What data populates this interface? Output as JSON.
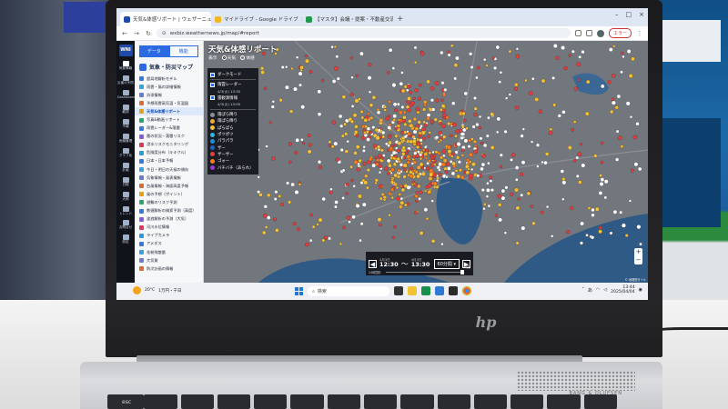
{
  "browser": {
    "tabs": [
      {
        "label": "天気&体感リポート | ウェザーニュース",
        "color": "#1f4aa8"
      },
      {
        "label": "マイドライブ - Google ドライブ",
        "color": "#f2b81c"
      },
      {
        "label": "【マスタ】会議・提案・不動産交流",
        "color": "#1e9a4a"
      }
    ],
    "url": "wxbiz.weathernews.jp/map/#report",
    "error_label": "エラー"
  },
  "rail": {
    "logo": "WNI",
    "items": [
      "気象情報",
      "災害の予防",
      "Dashboard",
      "観測",
      "予報",
      "危機管理",
      "グラフ化",
      "計画",
      "日程",
      "大雨",
      "トレンド",
      "お問合せ",
      "設定"
    ]
  },
  "sidebar": {
    "seg": [
      "データ",
      "機能"
    ],
    "heading": "気象・防災マップ",
    "items": [
      "超局地解析モデル",
      "雨雲・風の詳細情報",
      "渋滞情報",
      "予想雨雲高気温・気温図",
      "天気&体感リポート",
      "写真&動画リポート",
      "雨雲レーダー&落雷",
      "雷の状況・落雷リスク",
      "浸水リスクモニタリング",
      "危険度分布（キキクル）",
      "日本・日本予報",
      "今日・明日の天候の傾向",
      "気象情報・発表情報",
      "台風情報・海面高度予報",
      "風の予想（ポイント）",
      "避難のリスク予測",
      "数値解析の検索予測（高度）",
      "波浪解析の予測（大気）",
      "河川水位情報",
      "ライブカメラ",
      "アメダス",
      "花粉飛散量",
      "大気質",
      "防災計画の情報"
    ],
    "active_index": 4,
    "weather": {
      "temp": "20°C",
      "desc": "1万円・千日"
    }
  },
  "map": {
    "title": "天気&体感リポート",
    "radios": [
      "天気",
      "体感"
    ],
    "radio_prefix": "表示",
    "legend": {
      "dark_mode": "ダークモード",
      "layers": [
        {
          "label": "雨雲レーダー",
          "time": "4/3(火) 13:35"
        },
        {
          "label": "雷観測情報",
          "time": "4/3(火) 13:00"
        }
      ],
      "categories": [
        {
          "label": "雨ぱら降り",
          "color": "#8a8f99"
        },
        {
          "label": "雨ぱら降り",
          "color": "#f2a92a"
        },
        {
          "label": "ぱらぱら",
          "color": "#f5c033"
        },
        {
          "label": "ポツポツ",
          "color": "#29b6e8"
        },
        {
          "label": "パラパラ",
          "color": "#1a8ee0"
        },
        {
          "label": "ザー",
          "color": "#1467c9"
        },
        {
          "label": "ザーザー",
          "color": "#e63c3c"
        },
        {
          "label": "ゴォー",
          "color": "#ff7a1a"
        },
        {
          "label": "バチバチ（あられ）",
          "color": "#9b37d6"
        }
      ]
    },
    "timebar": {
      "from_date": "4月3日",
      "from_time": "12:30",
      "to_date": "4月3日",
      "to_time": "13:30",
      "interval": "60分間",
      "left_label": "24時間前",
      "right_label": "現在"
    },
    "attribution": "© 地理院タイル"
  },
  "taskbar": {
    "search_placeholder": "検索",
    "time": "13:44",
    "date": "2025/04/04",
    "ime": "あ"
  },
  "laptop": {
    "brand": "hp",
    "speaker_label": "BANG & OLUFSEN",
    "esc": "esc"
  }
}
